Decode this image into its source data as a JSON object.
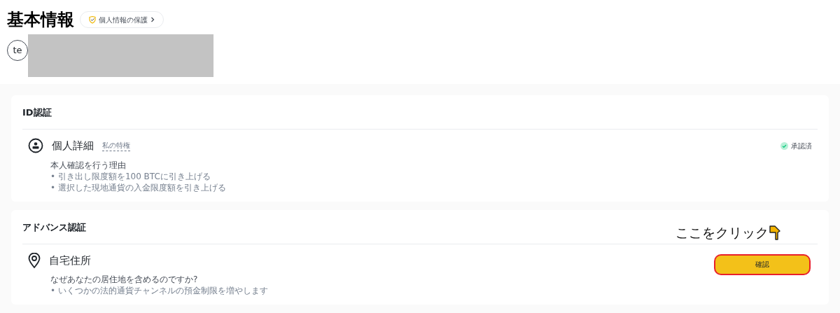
{
  "header": {
    "title": "基本情報",
    "privacy_link": "個人情報の保護",
    "avatar": "te"
  },
  "sections": [
    {
      "title": "ID認証",
      "item": {
        "name": "個人詳細",
        "tag": "私の特権",
        "kind": "status",
        "status": "承認済",
        "reason_title": "本人確認を行う理由",
        "reasons": [
          "• 引き出し限度額を100 BTCに引き上げる",
          "• 選択した現地通貨の入金限度額を引き上げる"
        ]
      }
    },
    {
      "title": "アドバンス認証",
      "item": {
        "name": "自宅住所",
        "kind": "button",
        "button": "確認",
        "highlighted": true,
        "annotation": "ここをクリック",
        "reason_title": "なぜあなたの居住地を含めるのですか?",
        "reasons": [
          "• いくつかの法的通貨チャンネルの預金制限を増やします"
        ]
      }
    }
  ]
}
